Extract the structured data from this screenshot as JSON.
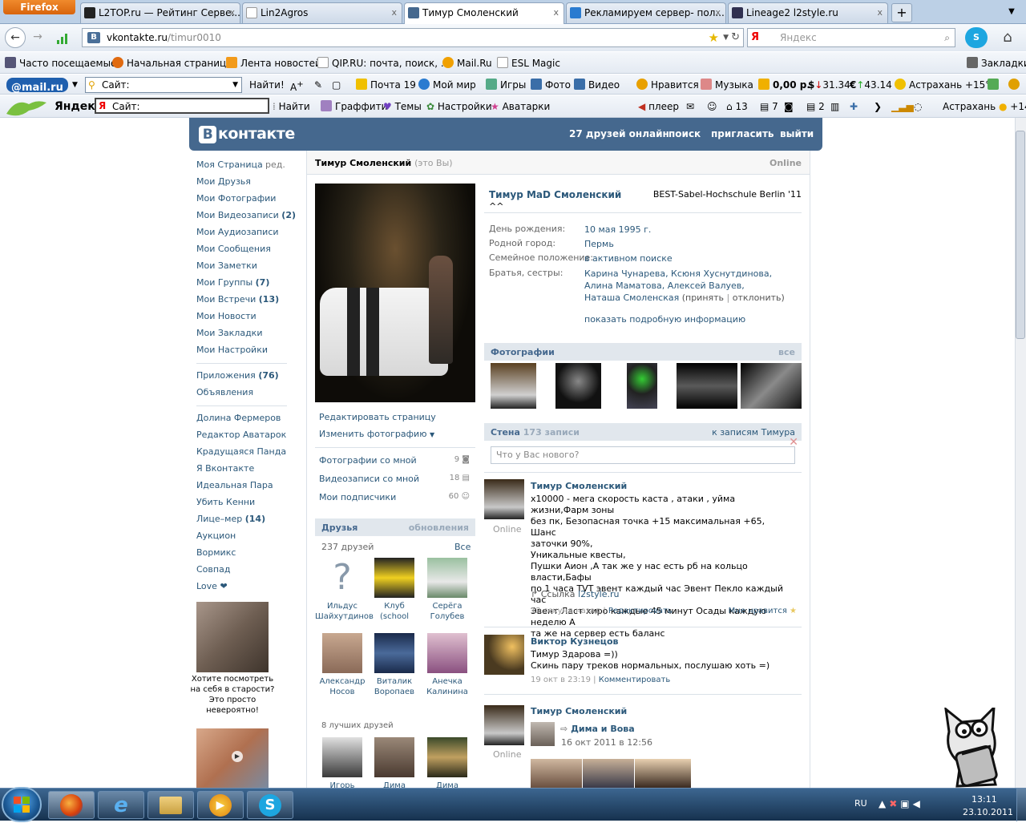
{
  "browser": {
    "app_button": "Firefox",
    "tabs": [
      {
        "label": "L2TOP.ru — Рейтинг Серве...",
        "x": "x"
      },
      {
        "label": "Lin2Agros",
        "x": "x"
      },
      {
        "label": "Тимур Смоленский",
        "x": "x"
      },
      {
        "label": "Рекламируем сервер- пол...",
        "x": "x"
      },
      {
        "label": "Lineage2 l2style.ru",
        "x": "x"
      }
    ],
    "url_host": "vkontakte.ru",
    "url_path": "/timur0010",
    "search_placeholder": "Яндекс",
    "search_engine_glyph": "Я"
  },
  "bookmarks": {
    "items": [
      "Часто посещаемые",
      "Начальная страница",
      "Лента новостей",
      "QIP.RU: почта, поиск, ...",
      "Mail.Ru",
      "ESL Magic"
    ],
    "right": "Закладки"
  },
  "mailru_bar": {
    "logo": "@mail.ru",
    "site_placeholder": "Сайт:",
    "find": "Найти!",
    "mail": "Почта 19",
    "my_world": "Мой мир",
    "games": "Игры",
    "photo": "Фото",
    "video": "Видео",
    "likes": "Нравится",
    "music": "Музыка",
    "balance": "0,00 р.",
    "usd": "31.34",
    "eur": "43.14",
    "weather": "Астрахань +15°C"
  },
  "yandex_bar": {
    "logo": "Яндекс",
    "site_placeholder": "Сайт:",
    "find": "Найти",
    "graffiti": "Граффити",
    "themes": "Темы",
    "settings": "Настройки",
    "avatars": "Аватарки",
    "player": "плеер",
    "count_13": "13",
    "count_7": "7",
    "count_2": "2",
    "weather": "Астрахань",
    "temp": "+14"
  },
  "vk_header": {
    "logo_letter": "В",
    "logo_text": "контакте",
    "friends_online": "27 друзей онлайн",
    "search": "поиск",
    "invite": "пригласить",
    "logout": "выйти"
  },
  "left_menu": {
    "my_page": "Моя Страница",
    "edit": "ред.",
    "items1": [
      {
        "label": "Мои Друзья",
        "count": ""
      },
      {
        "label": "Мои Фотографии",
        "count": ""
      },
      {
        "label": "Мои Видеозаписи",
        "count": "(2)"
      },
      {
        "label": "Мои Аудиозаписи",
        "count": ""
      },
      {
        "label": "Мои Сообщения",
        "count": ""
      },
      {
        "label": "Мои Заметки",
        "count": ""
      },
      {
        "label": "Мои Группы",
        "count": "(7)"
      },
      {
        "label": "Мои Встречи",
        "count": "(13)"
      },
      {
        "label": "Мои Новости",
        "count": ""
      },
      {
        "label": "Мои Закладки",
        "count": ""
      },
      {
        "label": "Мои Настройки",
        "count": ""
      }
    ],
    "items2": [
      {
        "label": "Приложения",
        "count": "(76)"
      },
      {
        "label": "Объявления",
        "count": ""
      }
    ],
    "items3": [
      {
        "label": "Долина Фермеров",
        "count": ""
      },
      {
        "label": "Редактор Аватарок",
        "count": ""
      },
      {
        "label": "Крадущаяся Панда",
        "count": ""
      },
      {
        "label": "Я Вконтакте",
        "count": ""
      },
      {
        "label": "Идеальная Пара",
        "count": ""
      },
      {
        "label": "Убить Кенни",
        "count": ""
      },
      {
        "label": "Лице–мер",
        "count": "(14)"
      },
      {
        "label": "Аукцион",
        "count": ""
      },
      {
        "label": "Вормикс",
        "count": ""
      },
      {
        "label": "Совпад",
        "count": ""
      },
      {
        "label": "Love ❤",
        "count": ""
      }
    ],
    "ad1_text": "Хотите посмотреть на себя в старости? Это просто невероятно!"
  },
  "profile": {
    "name": "Тимур Смоленский",
    "you": "(это Вы)",
    "online": "Online",
    "full_name": "Тимур MaD Смоленский",
    "status": "^^",
    "school": "BEST-Sabel-Hochschule Berlin '11",
    "birthday_label": "День рождения:",
    "birthday": "10 мая 1995 г.",
    "hometown_label": "Родной город:",
    "hometown": "Пермь",
    "family_label": "Семейное положение:",
    "family": "в активном поиске",
    "siblings_label": "Братья, сестры:",
    "siblings": "Карина Чунарева, Ксюня Хуснутдинова, Алина Маматова, Алексей Валуев,",
    "sibling_last": "Наташа Смоленская",
    "accept": "(принять",
    "reject": "отклонить)",
    "show_more": "показать подробную информацию",
    "edit_page": "Редактировать страницу",
    "change_photo": "Изменить фотографию",
    "photos_with_me": "Фотографии со мной",
    "photos_with_me_count": "9",
    "videos_with_me": "Видеозаписи со мной",
    "videos_with_me_count": "18",
    "subscribers": "Мои подписчики",
    "subscribers_count": "60"
  },
  "friends": {
    "title": "Друзья",
    "updates": "обновления",
    "count": "237 друзей",
    "all": "Все",
    "list": [
      {
        "name1": "Ильдус",
        "name2": "Шайхутдинов"
      },
      {
        "name1": "Клуб",
        "name2": "(school"
      },
      {
        "name1": "Серёга",
        "name2": "Голубев"
      },
      {
        "name1": "Александр",
        "name2": "Носов"
      },
      {
        "name1": "Виталик",
        "name2": "Воропаев"
      },
      {
        "name1": "Анечка",
        "name2": "Калинина"
      }
    ],
    "best_title": "8 лучших друзей",
    "best": [
      "Игорь",
      "Дима",
      "Дима"
    ]
  },
  "photos_section": {
    "title": "Фотографии",
    "all": "все"
  },
  "wall": {
    "title": "Стена",
    "count": "173 записи",
    "to_posts": "к записям Тимура",
    "input_placeholder": "Что у Вас нового?",
    "posts": [
      {
        "author": "Тимур Смоленский",
        "online": "Online",
        "lines": [
          "x10000 - мега скорость каста , атаки , уйма жизни,Фарм зоны",
          "без пк, Безопасная точка +15 максимальная +65, Шанс",
          "заточки 90%,",
          "Уникальные квесты,",
          "Пушки Аион ,А так же у нас есть рб на кольцо власти,Бафы",
          "по 1 часа TVT эвент каждый час Эвент Пекло каждый час",
          "Эвент Ласт хиро каждые 45 минут Осады каждую неделю А",
          "та же на сервер есть баланс"
        ],
        "link_label": "Ссылка",
        "link": "l2style.ru",
        "time": "12 секунд назад",
        "action": "Редактировать",
        "like": "Мне нравится"
      },
      {
        "author": "Виктор Кузнецов",
        "lines": [
          "Тимур Здарова =))",
          "Скинь пару треков нормальных, послушаю хоть =)"
        ],
        "time": "19 окт в 23:19",
        "action": "Комментировать"
      },
      {
        "author": "Тимур Смоленский",
        "online": "Online",
        "repost_group": "Дима и Вова",
        "repost_date": "16 окт 2011 в 12:56"
      }
    ]
  },
  "taskbar": {
    "lang": "RU",
    "time": "13:11",
    "date": "23.10.2011"
  },
  "colors": {
    "vk_blue": "#45688e",
    "link": "#2b587a",
    "section_bg": "#e1e7ed",
    "taskbar": "#1f3f62"
  }
}
